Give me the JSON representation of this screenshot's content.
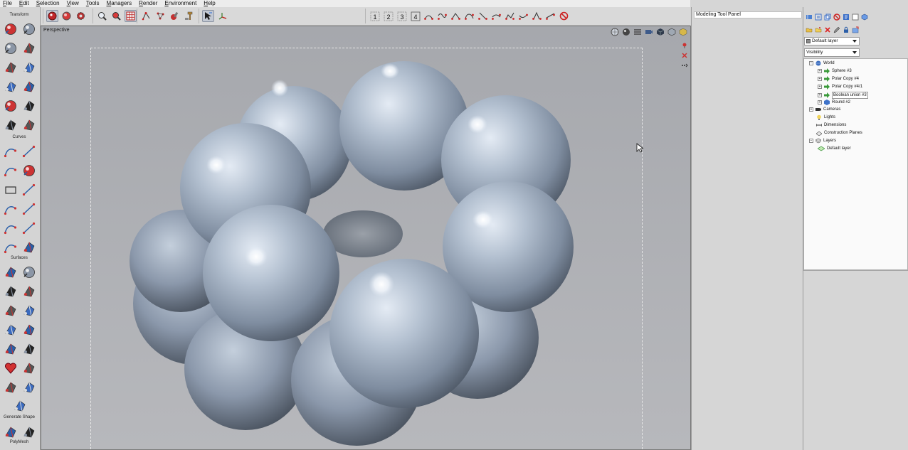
{
  "menubar": {
    "items": [
      "File",
      "Edit",
      "Selection",
      "View",
      "Tools",
      "Managers",
      "Render",
      "Environment",
      "Help"
    ]
  },
  "toolbar": {
    "group1": [
      "record-icon",
      "sphere-select-icon",
      "gear-render-icon"
    ],
    "group2": [
      "zoom-icon",
      "zoom-red-icon",
      "grid-icon"
    ],
    "group3": [
      "snap-points-icon",
      "snap-nodes-icon",
      "paint-icon",
      "hammer-icon"
    ],
    "group4": [
      "select-arrow-icon",
      "axis-icon"
    ],
    "group5_labels": [
      "1",
      "2",
      "3",
      "4"
    ],
    "group5_icons": [
      "curve-a-icon",
      "curve-b-icon",
      "curve-c-icon",
      "curve-d-icon",
      "curve-e-icon",
      "curve-f-icon",
      "curve-g-icon",
      "curve-h-icon",
      "curve-i-icon",
      "curve-j-icon",
      "no-entry-icon"
    ]
  },
  "toolbox": {
    "sections": {
      "transform": "Transform",
      "curves": "Curves",
      "surfaces": "Surfaces",
      "generate_shape": "Generate Shape",
      "polymesh": "PolyMesh"
    }
  },
  "viewport": {
    "label": "Perspective",
    "colors": {
      "background": "#a9abb0",
      "surface": "#8e9aa9",
      "highlight": "#f4f7fb"
    }
  },
  "modeling_panel": {
    "title": "Modeling Tool Panel"
  },
  "scene_panel": {
    "layer_dropdown": "Default layer",
    "visibility_dropdown": "Visibility",
    "tree": {
      "world": "World",
      "objects": [
        "Sphere #3",
        "Polar Copy #4",
        "Polar Copy #4/1",
        "Boolean union #3",
        "Round #2"
      ],
      "cameras": "Cameras",
      "lights": "Lights",
      "dimensions": "Dimensions",
      "construction_planes": "Construction Planes",
      "layers": "Layers",
      "default_layer": "Default layer"
    }
  }
}
